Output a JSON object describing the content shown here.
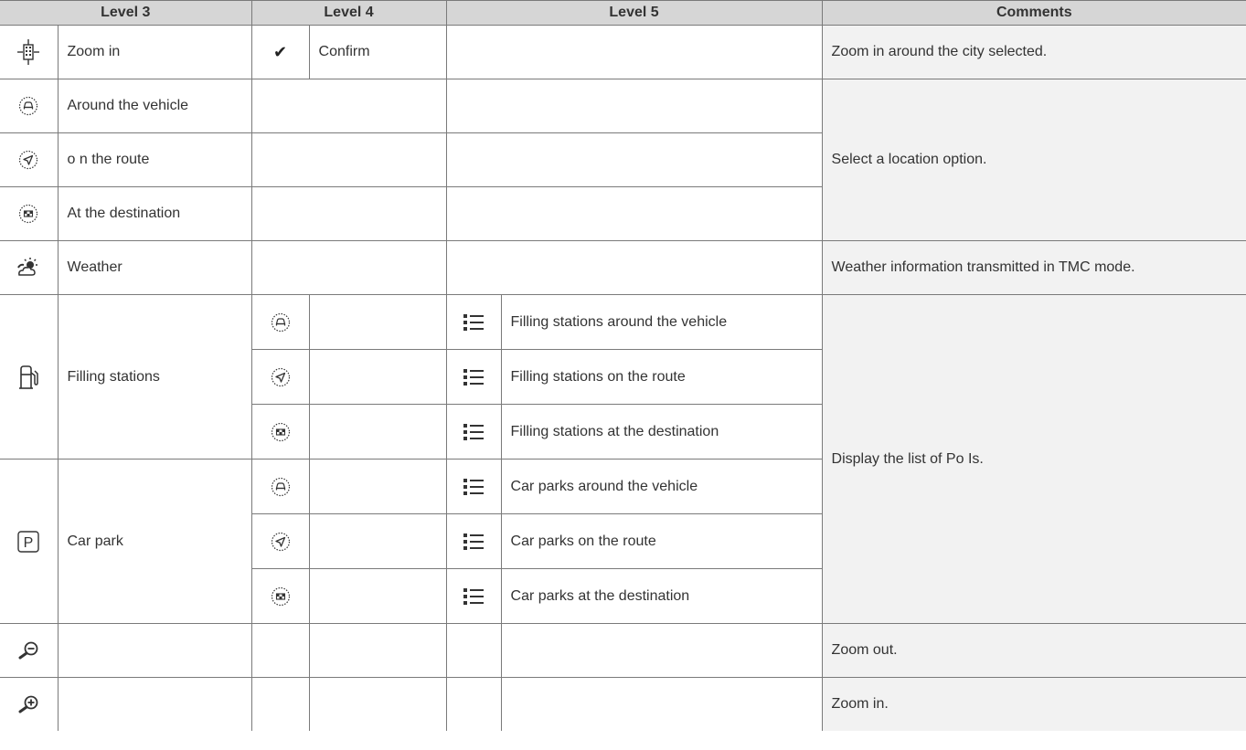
{
  "headers": {
    "level3": "Level 3",
    "level4": "Level 4",
    "level5": "Level 5",
    "comments": "Comments"
  },
  "rows": {
    "zoom_in": {
      "label": "Zoom in",
      "level4_label": "Confirm",
      "comment": "Zoom in around the city selected."
    },
    "location": {
      "around_vehicle": "Around the vehicle",
      "on_route": "o n the route",
      "at_destination": "At the destination",
      "comment": "Select a location option."
    },
    "weather": {
      "label": "Weather",
      "comment": "Weather information transmitted in TMC mode."
    },
    "filling": {
      "label": "Filling stations",
      "around": "Filling stations around the vehicle",
      "route": "Filling stations on the route",
      "destination": "Filling stations at the destination"
    },
    "carpark": {
      "label": "Car park",
      "around": "Car parks around the vehicle",
      "route": "Car parks on the route",
      "destination": "Car parks at the destination",
      "p_letter": "P"
    },
    "pois_comment": "Display the list of Po Is.",
    "zoom_out_comment": "Zoom out.",
    "zoom_in_comment": "Zoom in."
  },
  "icons": {
    "check": "✔",
    "map_pin": "map-crosshair-icon",
    "vehicle": "vehicle-location-icon",
    "route": "route-arrow-icon",
    "destination": "destination-flag-icon",
    "weather": "weather-sun-cloud-icon",
    "fuel": "fuel-pump-icon",
    "parking": "parking-icon",
    "list": "list-icon",
    "zoom_out": "magnifier-minus-icon",
    "zoom_in": "magnifier-plus-icon"
  },
  "colors": {
    "header_bg": "#d6d6d6",
    "comment_bg": "#f2f2f2",
    "border": "#7a7a7a",
    "text": "#333333"
  }
}
